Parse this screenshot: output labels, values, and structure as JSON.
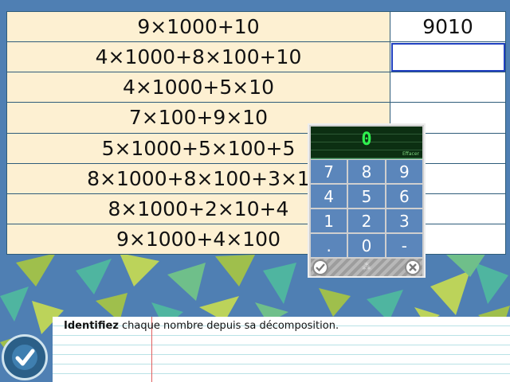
{
  "exercise": {
    "rows": [
      {
        "expression": "9×1000+10",
        "answer": "9010"
      },
      {
        "expression": "4×1000+8×100+10",
        "answer": ""
      },
      {
        "expression": "4×1000+5×10",
        "answer": ""
      },
      {
        "expression": "7×100+9×10",
        "answer": ""
      },
      {
        "expression": "5×1000+5×100+5",
        "answer": ""
      },
      {
        "expression": "8×1000+8×100+3×1",
        "answer": ""
      },
      {
        "expression": "8×1000+2×10+4",
        "answer": ""
      },
      {
        "expression": "9×1000+4×100",
        "answer": ""
      }
    ]
  },
  "keypad": {
    "display_value": "0",
    "clear_label": "Effacer",
    "keys": [
      "7",
      "8",
      "9",
      "4",
      "5",
      "6",
      "1",
      "2",
      "3",
      ".",
      "0",
      "-"
    ],
    "footer_mark": "⁂",
    "display_color": "#2ff24f"
  },
  "instruction": {
    "bold": "Identifiez",
    "text": " chaque nombre depuis sa décomposition."
  },
  "icons": {
    "validate": "checkmark-icon",
    "keypad_ok": "checkmark-icon",
    "keypad_cancel": "close-icon"
  },
  "colors": {
    "background": "#4f7fb3",
    "expression_cell": "#fdf0d2",
    "active_outline": "#2040c0"
  }
}
